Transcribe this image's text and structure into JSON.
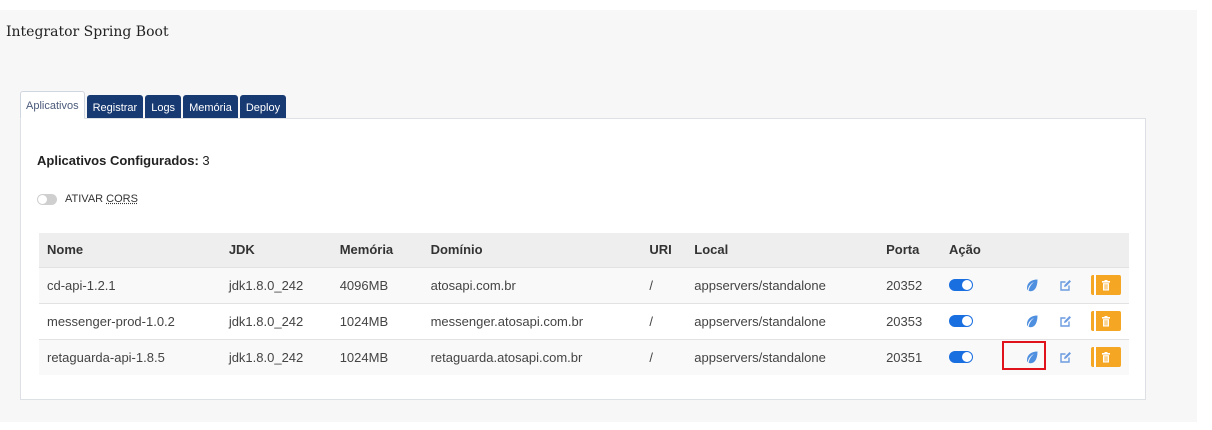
{
  "app": {
    "title": "Integrator Spring Boot"
  },
  "tabs": [
    {
      "label": "Aplicativos",
      "active": true
    },
    {
      "label": "Registrar",
      "active": false
    },
    {
      "label": "Logs",
      "active": false
    },
    {
      "label": "Memória",
      "active": false
    },
    {
      "label": "Deploy",
      "active": false
    }
  ],
  "panel": {
    "configured_label": "Aplicativos Configurados:",
    "configured_count": "3",
    "cors_label_prefix": "ATIVAR ",
    "cors_label_abbr": "CORS",
    "cors_enabled": false
  },
  "table": {
    "headers": [
      "Nome",
      "JDK",
      "Memória",
      "Domínio",
      "URI",
      "Local",
      "Porta",
      "Ação"
    ],
    "rows": [
      {
        "nome": "cd-api-1.2.1",
        "jdk": "jdk1.8.0_242",
        "memoria": "4096MB",
        "dominio": "atosapi.com.br",
        "uri": "/",
        "local": "appservers/standalone",
        "porta": "20352",
        "active": true
      },
      {
        "nome": "messenger-prod-1.0.2",
        "jdk": "jdk1.8.0_242",
        "memoria": "1024MB",
        "dominio": "messenger.atosapi.com.br",
        "uri": "/",
        "local": "appservers/standalone",
        "porta": "20353",
        "active": true
      },
      {
        "nome": "retaguarda-api-1.8.5",
        "jdk": "jdk1.8.0_242",
        "memoria": "1024MB",
        "dominio": "retaguarda.atosapi.com.br",
        "uri": "/",
        "local": "appservers/standalone",
        "porta": "20351",
        "active": true
      }
    ]
  },
  "icons": {
    "toggle": "toggle-on-icon",
    "spring": "spring-leaf-icon",
    "edit": "edit-icon",
    "delete": "trash-icon"
  },
  "colors": {
    "tab_bg": "#183a72",
    "toggle_on": "#1a6fe0",
    "leaf": "#4f8fe0",
    "edit": "#6d9ce0",
    "delete": "#f5a623",
    "highlight": "#e0131c"
  }
}
